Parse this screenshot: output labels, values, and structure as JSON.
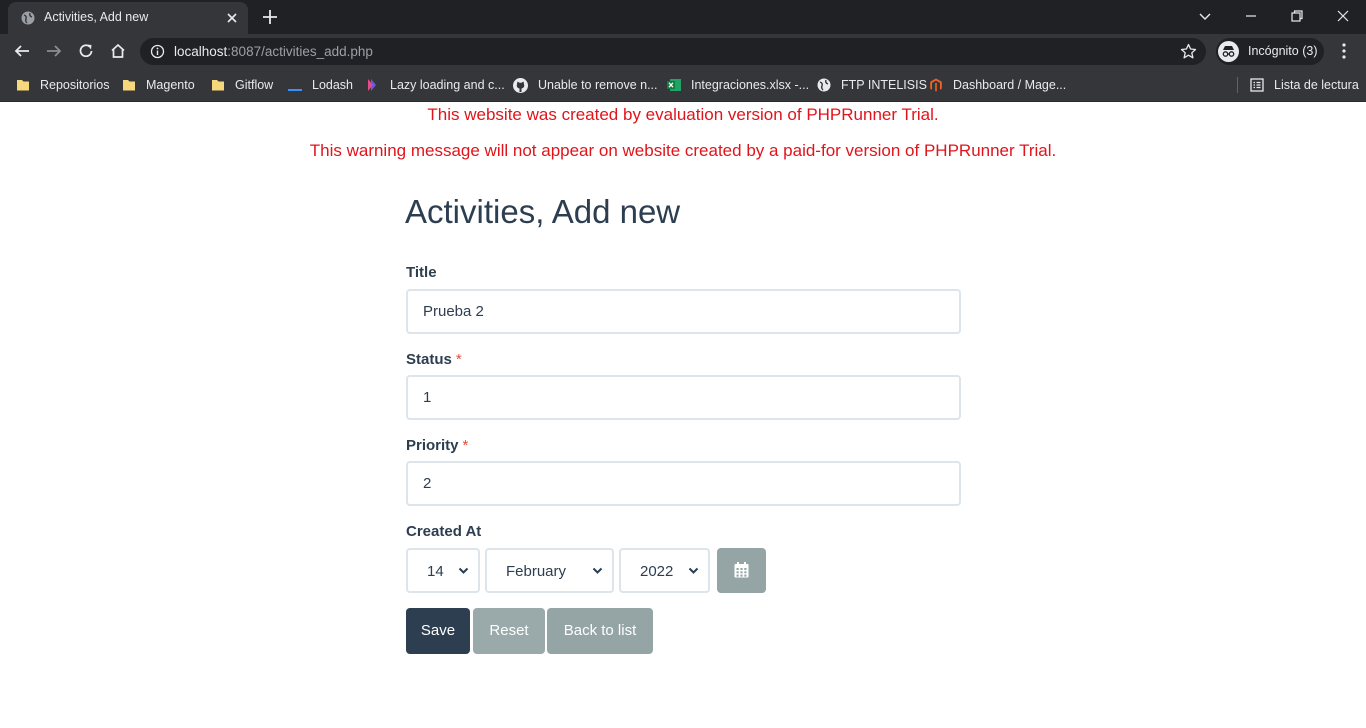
{
  "browser": {
    "tab_title": "Activities, Add new",
    "url_host": "localhost",
    "url_rest": ":8087/activities_add.php",
    "incognito_label": "Incógnito (3)",
    "reading_list": "Lista de lectura",
    "bookmarks": [
      {
        "label": "Repositorios",
        "icon": "folder-icon"
      },
      {
        "label": "Magento",
        "icon": "folder-icon"
      },
      {
        "label": "Gitflow",
        "icon": "folder-icon"
      },
      {
        "label": "Lodash",
        "icon": "lodash-icon"
      },
      {
        "label": "Lazy loading and c...",
        "icon": "page-icon"
      },
      {
        "label": "Unable to remove n...",
        "icon": "github-icon"
      },
      {
        "label": "Integraciones.xlsx -...",
        "icon": "excel-icon"
      },
      {
        "label": "FTP INTELISIS",
        "icon": "globe-icon"
      },
      {
        "label": "Dashboard / Mage...",
        "icon": "magento-icon"
      }
    ]
  },
  "page": {
    "warning_1": "This website was created by evaluation version of PHPRunner Trial.",
    "warning_2": "This warning message will not appear on website created by a paid-for version of PHPRunner Trial.",
    "title": "Activities, Add new"
  },
  "form": {
    "title": {
      "label": "Title",
      "value": "Prueba 2"
    },
    "status": {
      "label": "Status",
      "required": "*",
      "value": "1"
    },
    "priority": {
      "label": "Priority",
      "required": "*",
      "value": "2"
    },
    "created_at": {
      "label": "Created At",
      "day": "14",
      "month": "February",
      "year": "2022"
    }
  },
  "buttons": {
    "save": "Save",
    "reset": "Reset",
    "back": "Back to list"
  },
  "colors": {
    "warning": "#e0141b",
    "primary": "#2c3e50",
    "secondary": "#95a5a6",
    "required": "#e74c3c"
  }
}
